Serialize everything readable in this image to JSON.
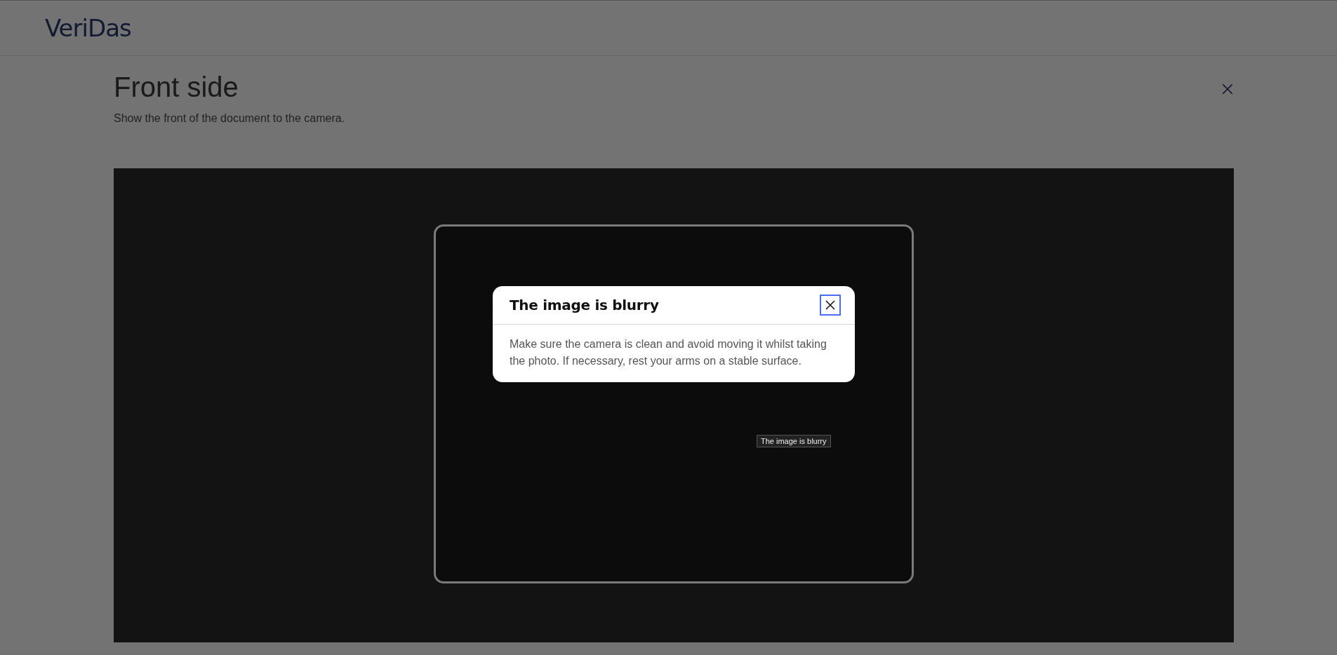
{
  "header": {
    "logo": "VeriDas"
  },
  "page": {
    "title": "Front side",
    "subtitle": "Show the front of the document to the camera."
  },
  "dialog": {
    "title": "The image is blurry",
    "message": "Make sure the camera is clean and avoid moving it whilst taking the photo. If necessary, rest your arms on a stable surface.",
    "close_focused": true
  },
  "tooltip": {
    "text": "The image is blurry"
  }
}
